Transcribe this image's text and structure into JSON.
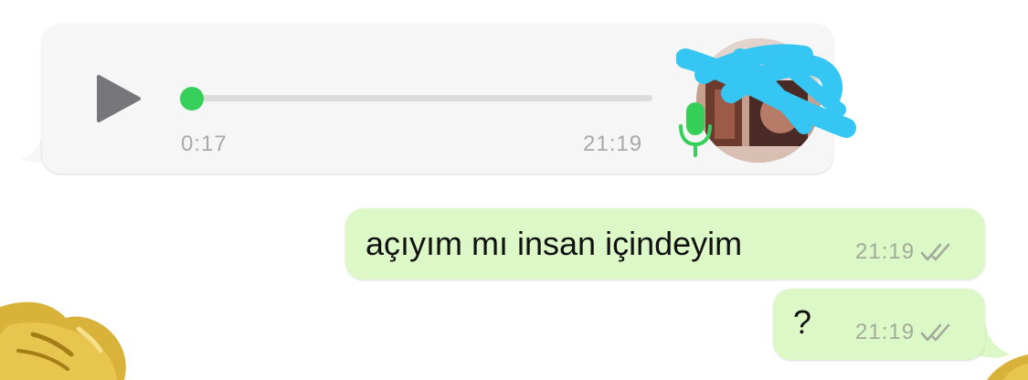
{
  "voice_message": {
    "duration": "0:17",
    "time": "21:19",
    "progress": 0.0,
    "play_icon": "play-icon",
    "mic_icon": "microphone-icon",
    "accent_color": "#35cf5a"
  },
  "outgoing_messages": [
    {
      "text": "açıyım mı insan içindeyim",
      "time": "21:19",
      "status_icon": "double-check-icon"
    },
    {
      "text": "?",
      "time": "21:19",
      "status_icon": "double-check-icon"
    }
  ],
  "colors": {
    "incoming_bubble": "#f6f6f6",
    "outgoing_bubble": "#ddf8c7",
    "timestamp": "#a9a9a9"
  }
}
